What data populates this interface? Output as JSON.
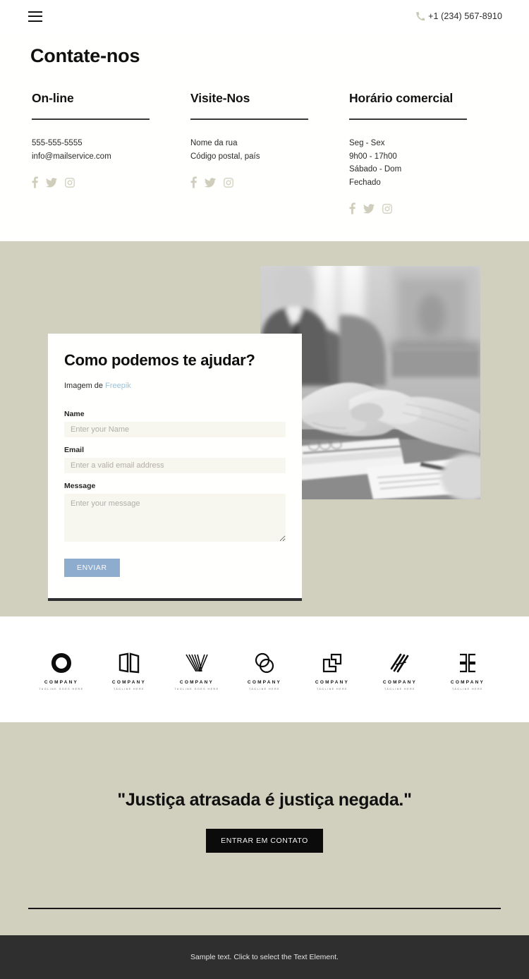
{
  "header": {
    "menu_icon": "hamburger-menu-icon",
    "phone_icon": "phone-icon",
    "phone": "+1 (234) 567-8910"
  },
  "page_title": "Contate-nos",
  "contact_columns": [
    {
      "heading": "On-line",
      "lines": [
        "555-555-5555",
        "info@mailservice.com"
      ],
      "socials": [
        "facebook-icon",
        "twitter-icon",
        "instagram-icon"
      ]
    },
    {
      "heading": "Visite-Nos",
      "lines": [
        "Nome da rua",
        "Código postal, país"
      ],
      "socials": [
        "facebook-icon",
        "twitter-icon",
        "instagram-icon"
      ]
    },
    {
      "heading": "Horário comercial",
      "lines": [
        "Seg - Sex",
        "9h00 - 17h00",
        "Sábado - Dom",
        "Fechado"
      ],
      "socials": [
        "facebook-icon",
        "twitter-icon",
        "instagram-icon"
      ]
    }
  ],
  "form": {
    "heading": "Como podemos te ajudar?",
    "credit_prefix": "Imagem de",
    "credit_link": "Freepik",
    "fields": [
      {
        "label": "Name",
        "placeholder": "Enter your Name",
        "value": ""
      },
      {
        "label": "Email",
        "placeholder": "Enter a valid email address",
        "value": ""
      },
      {
        "label": "Message",
        "placeholder": "Enter your message",
        "value": ""
      }
    ],
    "submit_label": "ENVIAR"
  },
  "hero_image": {
    "alt": "handshake-over-desk-photo"
  },
  "logos": [
    {
      "name": "COMPANY",
      "tagline": "TAGLINE GOES HERE",
      "mark": "ring-mark"
    },
    {
      "name": "COMPANY",
      "tagline": "TAGLINE HERE",
      "mark": "open-book-mark"
    },
    {
      "name": "COMPANY",
      "tagline": "TAGLINE GOES HERE",
      "mark": "striped-v-mark"
    },
    {
      "name": "COMPANY",
      "tagline": "TAGLINE HERE",
      "mark": "two-circles-mark"
    },
    {
      "name": "COMPANY",
      "tagline": "TAGLINE HERE",
      "mark": "squares-mark"
    },
    {
      "name": "COMPANY",
      "tagline": "TAGLINE HERE",
      "mark": "diagonal-lines-mark"
    },
    {
      "name": "COMPANY",
      "tagline": "TAGLINE HERE",
      "mark": "double-b-mark"
    }
  ],
  "quote": {
    "text": "\"Justiça atrasada é justiça negada.\"",
    "cta_label": "ENTRAR EM CONTATO"
  },
  "footer": {
    "text": "Sample text. Click to select the Text Element."
  },
  "colors": {
    "band_background": "#d1d0be",
    "footer_background": "#2f2f2f",
    "submit_button": "#8eaccd",
    "cta_button": "#0b0b0b",
    "link": "#9fc2d6",
    "social_icon": "#cfcebc",
    "input_background": "#f7f6ef"
  }
}
